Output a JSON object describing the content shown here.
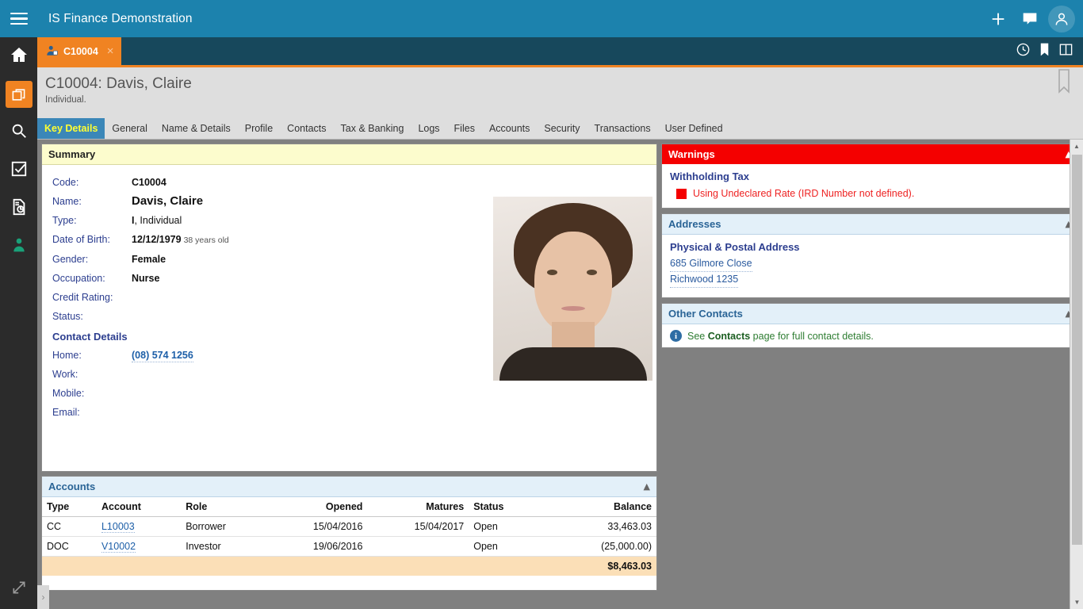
{
  "app": {
    "title": "IS Finance Demonstration",
    "menu_icon": "hamburger-icon",
    "top_actions": [
      {
        "name": "add-button",
        "icon": "plus-icon"
      },
      {
        "name": "messages-button",
        "icon": "chat-icon"
      },
      {
        "name": "user-account-button",
        "icon": "user-avatar-icon"
      }
    ],
    "rail_items": [
      {
        "name": "home",
        "icon": "home-icon",
        "active": false
      },
      {
        "name": "windows",
        "icon": "windows-icon",
        "active": true
      },
      {
        "name": "search",
        "icon": "search-icon",
        "active": false
      },
      {
        "name": "tasks",
        "icon": "checkbox-icon",
        "active": false
      },
      {
        "name": "reports",
        "icon": "report-icon",
        "active": false
      },
      {
        "name": "client",
        "icon": "person-icon",
        "active": false
      }
    ],
    "rail_bottom_icon": "expand-arrows-icon",
    "expander_label": "›"
  },
  "doc_tab": {
    "label": "C10004",
    "icon": "client-record-icon",
    "close_label": "×"
  },
  "tabbar_actions": [
    {
      "name": "history-button",
      "icon": "clock-icon"
    },
    {
      "name": "bookmarks-button",
      "icon": "bookmark-icon"
    },
    {
      "name": "split-view-button",
      "icon": "panel-layout-icon"
    }
  ],
  "page": {
    "title": "C10004: Davis, Claire",
    "subtitle": "Individual.",
    "ribbon_icon": "bookmark-outline-icon"
  },
  "nav_tabs": [
    {
      "label": "Key Details",
      "active": true
    },
    {
      "label": "General",
      "active": false
    },
    {
      "label": "Name & Details",
      "active": false
    },
    {
      "label": "Profile",
      "active": false
    },
    {
      "label": "Contacts",
      "active": false
    },
    {
      "label": "Tax & Banking",
      "active": false
    },
    {
      "label": "Logs",
      "active": false
    },
    {
      "label": "Files",
      "active": false
    },
    {
      "label": "Accounts",
      "active": false
    },
    {
      "label": "Security",
      "active": false
    },
    {
      "label": "Transactions",
      "active": false
    },
    {
      "label": "User Defined",
      "active": false
    }
  ],
  "summary": {
    "header": "Summary",
    "fields": [
      {
        "label": "Code:",
        "value": "C10004",
        "style": "bold"
      },
      {
        "label": "Name:",
        "value": "Davis, Claire",
        "style": "name"
      },
      {
        "label": "Type:",
        "value_bold": "I",
        "value_rest": ", Individual",
        "style": "mixed"
      },
      {
        "label": "Date of Birth:",
        "value": "12/12/1979",
        "suffix": "38 years old",
        "style": "bold"
      },
      {
        "label": "Gender:",
        "value": "Female",
        "style": "bold"
      },
      {
        "label": "Occupation:",
        "value": "Nurse",
        "style": "bold"
      },
      {
        "label": "Credit Rating:",
        "value": "",
        "style": "bold"
      },
      {
        "label": "Status:",
        "value": "",
        "style": "bold"
      }
    ],
    "photo_alt": "client-photo"
  },
  "contact_details": {
    "header": "Contact Details",
    "rows": [
      {
        "label": "Home:",
        "value": "(08) 574 1256",
        "is_link": true
      },
      {
        "label": "Work:",
        "value": "",
        "is_link": false
      },
      {
        "label": "Mobile:",
        "value": "",
        "is_link": false
      },
      {
        "label": "Email:",
        "value": "",
        "is_link": false
      }
    ]
  },
  "accounts": {
    "header": "Accounts",
    "collapse_icon": "chevron-up-icon",
    "columns": [
      "Type",
      "Account",
      "Role",
      "Opened",
      "Matures",
      "Status",
      "",
      "Balance"
    ],
    "rows": [
      {
        "type": "CC",
        "account": "L10003",
        "role": "Borrower",
        "opened": "15/04/2016",
        "matures": "15/04/2017",
        "status": "Open",
        "spacer": "",
        "balance": "33,463.03"
      },
      {
        "type": "DOC",
        "account": "V10002",
        "role": "Investor",
        "opened": "19/06/2016",
        "matures": "",
        "status": "Open",
        "spacer": "",
        "balance": "(25,000.00)"
      }
    ],
    "total": "$8,463.03"
  },
  "warnings": {
    "header": "Warnings",
    "collapse_icon": "chevron-up-icon",
    "title": "Withholding Tax",
    "message": "Using Undeclared Rate (IRD Number not defined)."
  },
  "addresses": {
    "header": "Addresses",
    "collapse_icon": "chevron-up-icon",
    "title": "Physical & Postal Address",
    "line1": "685 Gilmore Close",
    "line2": "Richwood  1235"
  },
  "other_contacts": {
    "header": "Other Contacts",
    "collapse_icon": "chevron-up-icon",
    "info_icon": "info-icon",
    "text_before": "See ",
    "text_link": "Contacts",
    "text_after": " page for full contact details."
  },
  "colors": {
    "topbar": "#1c82ad",
    "tabbar": "#17485c",
    "accent_orange": "#f08322",
    "active_tab_blue": "#3b87b8",
    "active_tab_text": "#ffff33",
    "warning_red": "#f40000",
    "panel_blue": "#e3f0f9",
    "summary_yellow": "#fcfccd",
    "total_row": "#fbdfb7",
    "page_bg": "#808080"
  }
}
